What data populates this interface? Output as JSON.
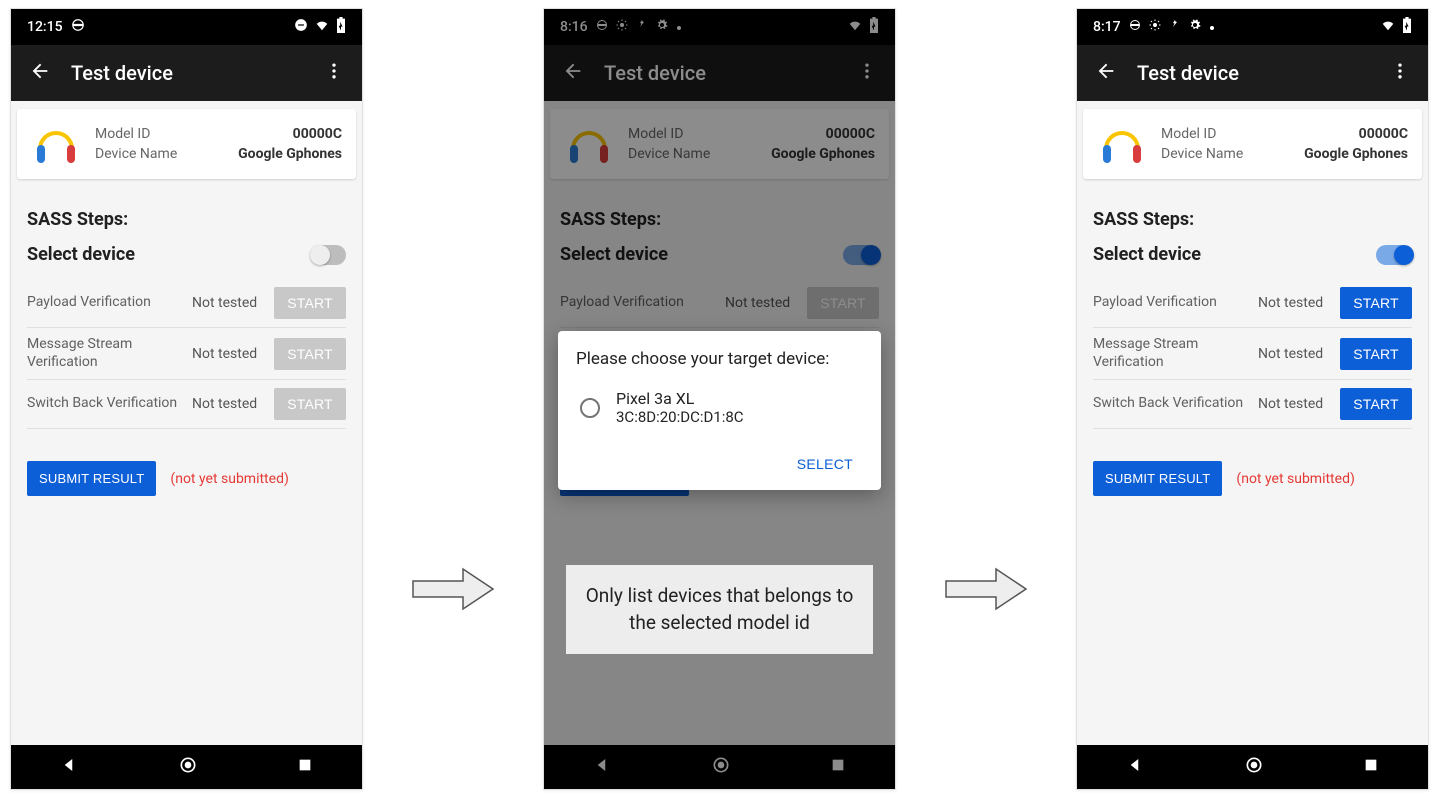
{
  "screens": [
    {
      "status_time": "12:15",
      "status_icons_left": [
        "theta-icon"
      ],
      "status_icons_right": [
        "do-not-disturb-icon",
        "wifi-icon",
        "battery-icon"
      ],
      "toggle_on": false,
      "start_enabled": false
    },
    {
      "status_time": "8:16",
      "status_icons_left": [
        "theta-icon",
        "brightness-icon",
        "signal-icon",
        "gear-icon",
        "dot-icon"
      ],
      "status_icons_right": [
        "wifi-icon",
        "battery-icon"
      ],
      "toggle_on": true,
      "start_enabled": false,
      "dialog": true
    },
    {
      "status_time": "8:17",
      "status_icons_left": [
        "theta-icon",
        "brightness-icon",
        "signal-icon",
        "gear-icon",
        "dot-icon"
      ],
      "status_icons_right": [
        "wifi-icon",
        "battery-icon"
      ],
      "toggle_on": true,
      "start_enabled": true
    }
  ],
  "appbar_title": "Test device",
  "card": {
    "model_label": "Model ID",
    "model_value": "00000C",
    "name_label": "Device Name",
    "name_value": "Google Gphones"
  },
  "section_title": "SASS Steps:",
  "select_device_label": "Select device",
  "tests": [
    {
      "label": "Payload Verification",
      "status": "Not tested"
    },
    {
      "label": "Message Stream Verification",
      "status": "Not tested"
    },
    {
      "label": "Switch Back Verification",
      "status": "Not tested"
    }
  ],
  "start_label": "START",
  "submit_label": "SUBMIT RESULT",
  "not_submitted_label": "(not yet submitted)",
  "dialog": {
    "title": "Please choose your target device:",
    "option_name": "Pixel 3a XL",
    "option_mac": "3C:8D:20:DC:D1:8C",
    "select_label": "SELECT"
  },
  "note": "Only list devices that belongs to the selected model id"
}
